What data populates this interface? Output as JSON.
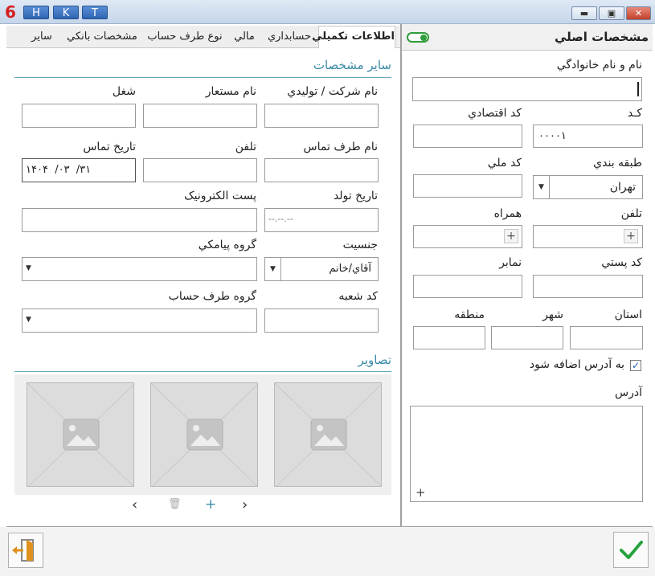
{
  "title_bar": {
    "app_logo": "6",
    "shortcut_keys": [
      "H",
      "K",
      "T"
    ],
    "window_controls": [
      "minimize",
      "restore",
      "close"
    ]
  },
  "tabs": [
    {
      "label": "مشخصات اصلي",
      "active": true
    },
    {
      "label": "اطلاعات تکميلي",
      "active": true
    },
    {
      "label": "حسابداري"
    },
    {
      "label": "مالي"
    },
    {
      "label": "نوع طرف حساب"
    },
    {
      "label": "مشخصات بانکي"
    },
    {
      "label": "ساير"
    }
  ],
  "toggle": {
    "state": "on",
    "color": "#2e9d3a"
  },
  "main": {
    "full_name_label": "نام و نام خانوادگي",
    "full_name_value": "",
    "code_label": "کـد",
    "code_value": "۰۰۰۰۱",
    "economic_code_label": "کد اقتصادي",
    "economic_code_value": "",
    "category_label": "طبقه بندي",
    "category_value": "تهران",
    "national_code_label": "کد ملي",
    "national_code_value": "",
    "phone_label": "تلفن",
    "mobile_label": "همراه",
    "postal_code_label": "کد پستي",
    "fax_label": "نمابر",
    "province_label": "استان",
    "city_label": "شهر",
    "region_label": "منطقه",
    "add_to_address_label": "به آدرس اضافه شود",
    "add_to_address_checked": true,
    "address_label": "آدرس"
  },
  "extra": {
    "section_title": "ساير مشخصات",
    "company_label": "نام شرکت / توليدي",
    "alias_label": "نام مستعار",
    "job_label": "شغل",
    "contact_name_label": "نام طرف تماس",
    "contact_phone_label": "تلفن",
    "contact_date_label": "تاريخ تماس",
    "contact_date_value": "۱۴۰۴  /۰۳  /۳۱",
    "birth_date_label": "تاريخ تولد",
    "birth_date_value": "--.--.--",
    "email_label": "پست الکترونيک",
    "gender_label": "جنسيت",
    "gender_value": "آقاي/خانم",
    "sms_group_label": "گروه پيامکي",
    "branch_code_label": "کد شعبه",
    "account_group_label": "گروه طرف حساب",
    "images_title": "تصاوير"
  },
  "footer": {
    "confirm": "check-icon",
    "exit": "exit-icon"
  },
  "colors": {
    "accent": "#3a8aa8",
    "check": "#27a33d",
    "exit": "#e0901c"
  }
}
